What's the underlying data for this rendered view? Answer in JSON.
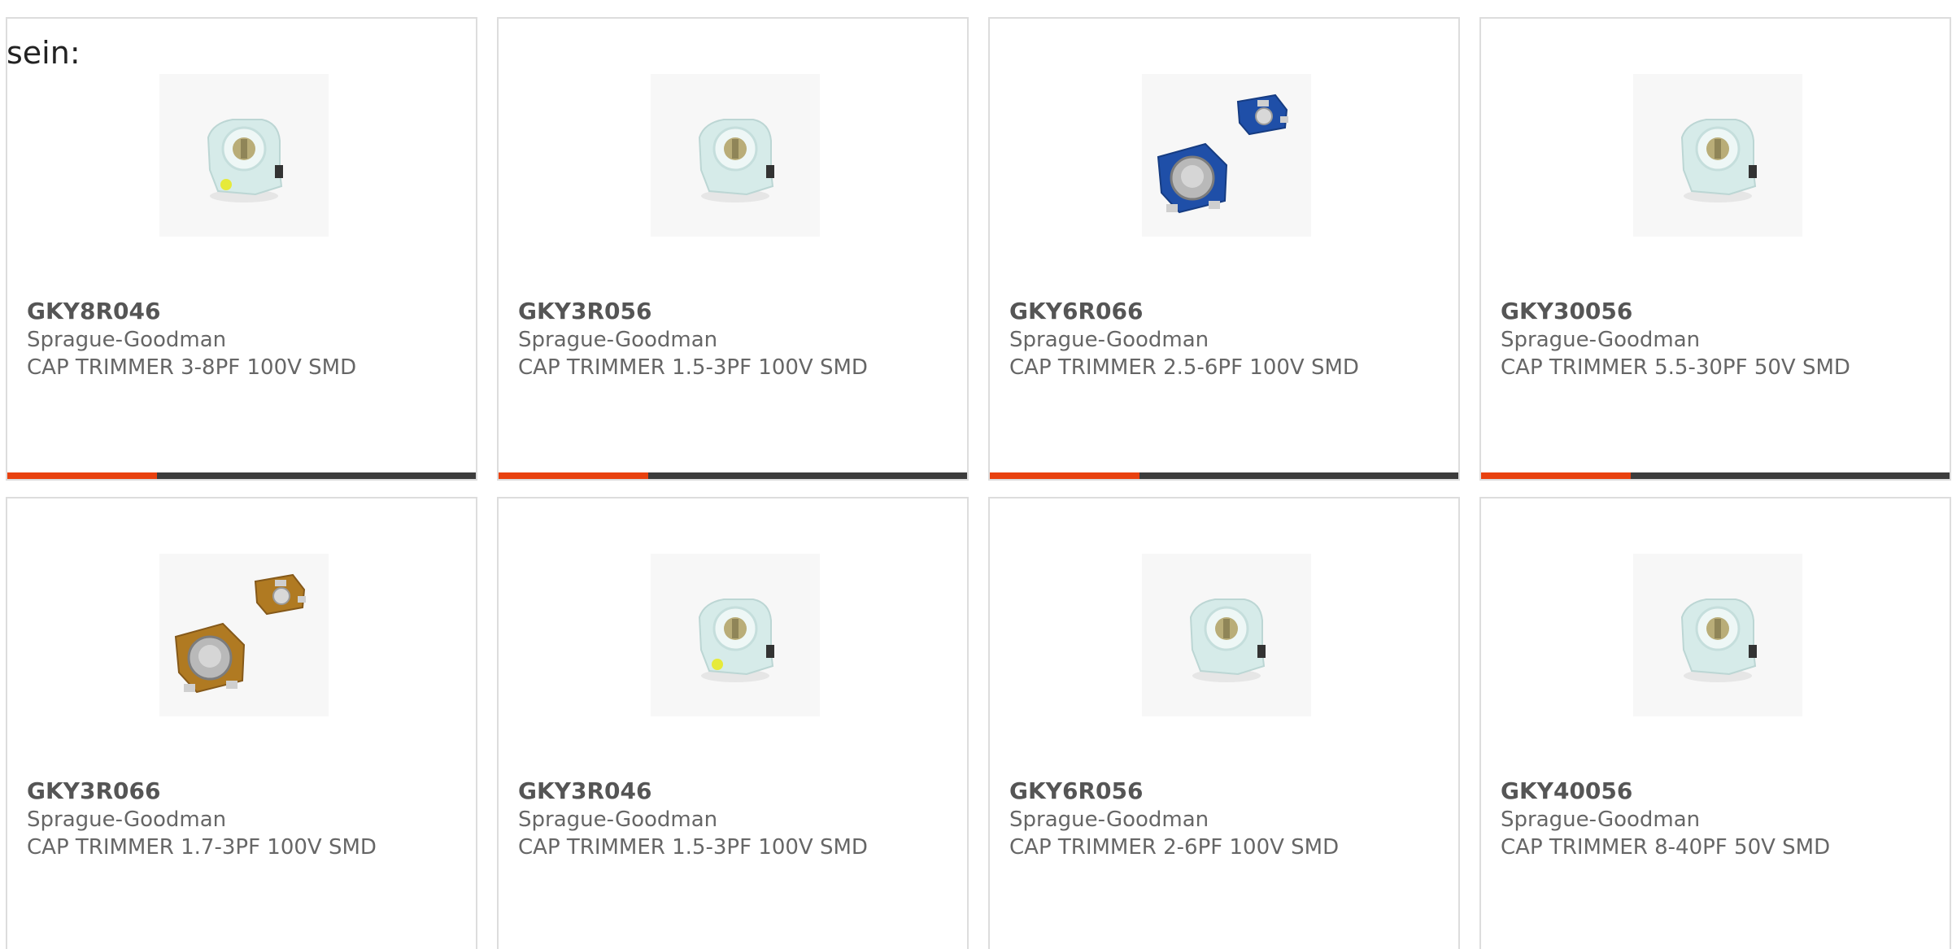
{
  "intro": {
    "text": "sein:"
  },
  "colors": {
    "accent": "#e8410f",
    "track": "#3c3c3c",
    "card_border": "#dddddd",
    "text_dark": "#555555",
    "text_muted": "#666666"
  },
  "products": [
    {
      "part": "GKY8R046",
      "maker": "Sprague-Goodman",
      "desc": "CAP TRIMMER 3-8PF 100V SMD",
      "image": "trimmer-white-yellow",
      "progress": 0.32
    },
    {
      "part": "GKY3R056",
      "maker": "Sprague-Goodman",
      "desc": "CAP TRIMMER 1.5-3PF 100V SMD",
      "image": "trimmer-white",
      "progress": 0.32
    },
    {
      "part": "GKY6R066",
      "maker": "Sprague-Goodman",
      "desc": "CAP TRIMMER 2.5-6PF 100V SMD",
      "image": "trimmer-blue-pair",
      "progress": 0.32
    },
    {
      "part": "GKY30056",
      "maker": "Sprague-Goodman",
      "desc": "CAP TRIMMER 5.5-30PF 50V SMD",
      "image": "trimmer-white",
      "progress": 0.32
    },
    {
      "part": "GKY3R066",
      "maker": "Sprague-Goodman",
      "desc": "CAP TRIMMER 1.7-3PF 100V SMD",
      "image": "trimmer-brown-pair",
      "progress": null
    },
    {
      "part": "GKY3R046",
      "maker": "Sprague-Goodman",
      "desc": "CAP TRIMMER 1.5-3PF 100V SMD",
      "image": "trimmer-white-yellow",
      "progress": null
    },
    {
      "part": "GKY6R056",
      "maker": "Sprague-Goodman",
      "desc": "CAP TRIMMER 2-6PF 100V SMD",
      "image": "trimmer-white",
      "progress": null
    },
    {
      "part": "GKY40056",
      "maker": "Sprague-Goodman",
      "desc": "CAP TRIMMER 8-40PF 50V SMD",
      "image": "trimmer-white",
      "progress": null
    }
  ]
}
